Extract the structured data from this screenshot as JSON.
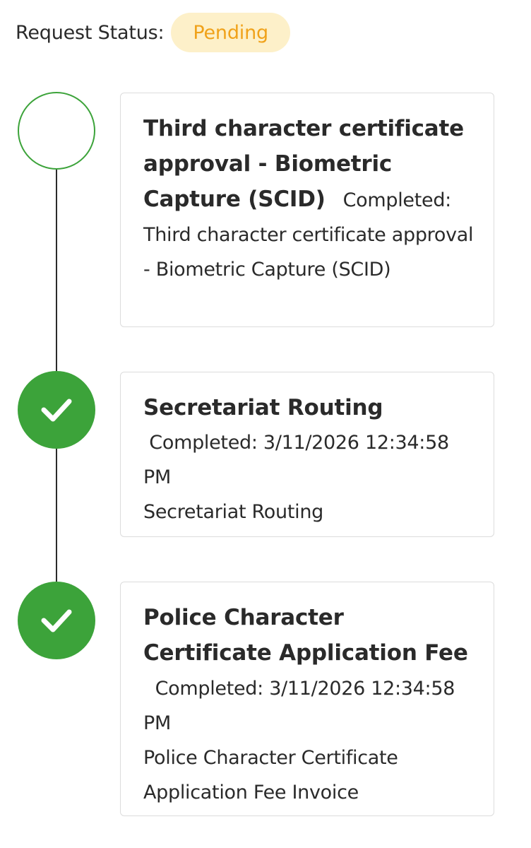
{
  "status": {
    "label": "Request Status:",
    "badge": "Pending",
    "badge_bg": "#fdf0c9",
    "badge_color": "#f0a21a"
  },
  "timeline": {
    "accent": "#3ca33a",
    "steps": [
      {
        "state": "pending",
        "icon": "empty-circle-icon",
        "title": "Third character certificate approval - Biometric Capture (SCID)",
        "completed": "Completed:",
        "detail": "Third character certificate approval - Biometric Capture (SCID)"
      },
      {
        "state": "done",
        "icon": "checkmark-icon",
        "title": "Secretariat Routing",
        "completed": "Completed: 3/11/2026 12:34:58 PM",
        "detail": "Secretariat Routing"
      },
      {
        "state": "done",
        "icon": "checkmark-icon",
        "title": "Police Character Certificate Application Fee",
        "completed": "Completed: 3/11/2026 12:34:58 PM",
        "detail": "Police Character Certificate Application Fee Invoice"
      }
    ]
  }
}
